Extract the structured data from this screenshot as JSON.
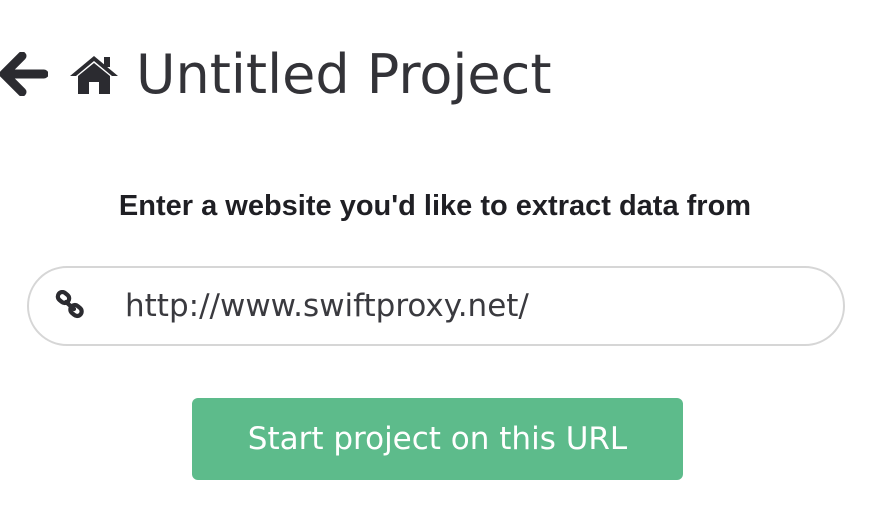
{
  "header": {
    "back_icon": "arrow-left-icon",
    "home_icon": "home-icon",
    "title": "Untitled Project"
  },
  "main": {
    "prompt": "Enter a website you'd like to extract data from",
    "url_field": {
      "icon": "link-icon",
      "value": "http://www.swiftproxy.net/"
    },
    "start_button_label": "Start project on this URL"
  },
  "colors": {
    "accent": "#5dbb8b",
    "text": "#333338",
    "field_border": "#d6d6d6"
  }
}
